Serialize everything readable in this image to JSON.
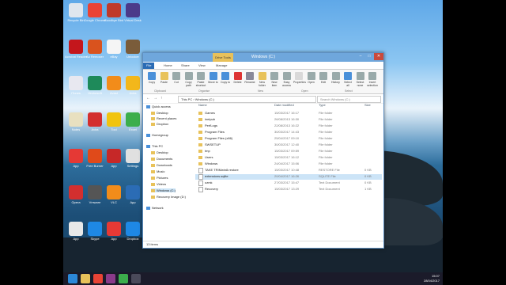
{
  "desktop": {
    "icons": [
      {
        "label": "Recycle Bin",
        "color": "#dfe6ee"
      },
      {
        "label": "Google Chrome",
        "color": "#e94335"
      },
      {
        "label": "Goodbye Bird",
        "color": "#c0392b"
      },
      {
        "label": "Virtual Desk",
        "color": "#4b3a8a"
      },
      {
        "label": "Acrobat Reader DC",
        "color": "#c4161c"
      },
      {
        "label": "Ad Remover",
        "color": "#d9531e"
      },
      {
        "label": "eBay",
        "color": "#f5f5f5"
      },
      {
        "label": "Unlocker",
        "color": "#7a5c3a"
      },
      {
        "label": "iTunes",
        "color": "#e8e8f0"
      },
      {
        "label": "Vectorsoft",
        "color": "#1e8a5a"
      },
      {
        "label": "Avast",
        "color": "#f28c1a"
      },
      {
        "label": "Avira",
        "color": "#f3b71b"
      },
      {
        "label": "Notes",
        "color": "#e8e0c0"
      },
      {
        "label": "Avira",
        "color": "#d32f2f"
      },
      {
        "label": "Tool",
        "color": "#f1c40f"
      },
      {
        "label": "Excel",
        "color": "#3cae4c"
      },
      {
        "label": "App",
        "color": "#e53935"
      },
      {
        "label": "Free Burner",
        "color": "#e04a1a"
      },
      {
        "label": "App",
        "color": "#c62828"
      },
      {
        "label": "Settings",
        "color": "#e0e0e0"
      },
      {
        "label": "Opera",
        "color": "#d32f2f"
      },
      {
        "label": "Vmware",
        "color": "#555"
      },
      {
        "label": "VLC",
        "color": "#f28c1a"
      },
      {
        "label": "App",
        "color": "#2b6cb5"
      },
      {
        "label": "App",
        "color": "#e8e8e8"
      },
      {
        "label": "Skype",
        "color": "#1e88e5"
      },
      {
        "label": "App",
        "color": "#e53935"
      },
      {
        "label": "Dropbox",
        "color": "#1e88e5"
      }
    ]
  },
  "taskbar": {
    "items": [
      {
        "name": "start-button",
        "color": "#2b88d8"
      },
      {
        "name": "file-explorer",
        "color": "#e8c25a"
      },
      {
        "name": "chrome",
        "color": "#e94335"
      },
      {
        "name": "media",
        "color": "#8a3a8a"
      },
      {
        "name": "app",
        "color": "#3cae4c"
      },
      {
        "name": "explorer-active",
        "color": "#4a4a5a"
      }
    ],
    "time": "15:07",
    "date": "28/04/2017"
  },
  "window": {
    "title": "Windows (C:)",
    "tools_tab": "Drive Tools",
    "tabs": [
      "File",
      "Home",
      "Share",
      "View",
      "Manage"
    ],
    "ribbon": {
      "buttons": [
        "Copy",
        "Paste",
        "Cut",
        "Copy path",
        "Paste shortcut",
        "Move to",
        "Copy to",
        "Delete",
        "Rename",
        "New folder",
        "New item",
        "Easy access",
        "Properties",
        "Open",
        "Edit",
        "History",
        "Select all",
        "Select none",
        "Invert selection"
      ],
      "groups": [
        "Clipboard",
        "Organise",
        "New",
        "Open",
        "Select"
      ]
    },
    "address": "This PC  ›  Windows (C:)",
    "search_placeholder": "Search Windows (C:)",
    "nav": [
      {
        "label": "Quick access",
        "indent": 0
      },
      {
        "label": "Desktop",
        "indent": 1
      },
      {
        "label": "Recent places",
        "indent": 1
      },
      {
        "label": "Dropbox",
        "indent": 1
      },
      {
        "label": "Homegroup",
        "indent": 0
      },
      {
        "label": "This PC",
        "indent": 0
      },
      {
        "label": "Desktop",
        "indent": 1
      },
      {
        "label": "Documents",
        "indent": 1
      },
      {
        "label": "Downloads",
        "indent": 1
      },
      {
        "label": "Music",
        "indent": 1
      },
      {
        "label": "Pictures",
        "indent": 1
      },
      {
        "label": "Videos",
        "indent": 1
      },
      {
        "label": "Windows (C:)",
        "indent": 1
      },
      {
        "label": "Recovery Image (D:)",
        "indent": 1
      },
      {
        "label": "Network",
        "indent": 0
      }
    ],
    "columns": [
      "Name",
      "Date modified",
      "Type",
      "Size"
    ],
    "files": [
      {
        "name": "Games",
        "date": "15/03/2017 16:17",
        "type": "File folder",
        "size": "",
        "kind": "folder"
      },
      {
        "name": "inetpub",
        "date": "26/08/2013 16:30",
        "type": "File folder",
        "size": "",
        "kind": "folder"
      },
      {
        "name": "PerfLogs",
        "date": "22/08/2013 16:22",
        "type": "File folder",
        "size": "",
        "kind": "folder"
      },
      {
        "name": "Program Files",
        "date": "30/03/2017 14:43",
        "type": "File folder",
        "size": "",
        "kind": "folder"
      },
      {
        "name": "Program Files (x86)",
        "date": "25/04/2017 09:10",
        "type": "File folder",
        "size": "",
        "kind": "folder"
      },
      {
        "name": "SWSETUP",
        "date": "30/03/2017 12:40",
        "type": "File folder",
        "size": "",
        "kind": "folder"
      },
      {
        "name": "tmp",
        "date": "15/03/2017 09:59",
        "type": "File folder",
        "size": "",
        "kind": "folder"
      },
      {
        "name": "Users",
        "date": "15/03/2017 16:12",
        "type": "File folder",
        "size": "",
        "kind": "folder"
      },
      {
        "name": "Windows",
        "date": "24/04/2017 15:06",
        "type": "File folder",
        "size": "",
        "kind": "folder"
      },
      {
        "name": "TAKE TRIMwin8.restore",
        "date": "15/03/2017 10:48",
        "type": "RESTORE File",
        "size": "0 KB",
        "kind": "file"
      },
      {
        "name": "extensions.sqlite",
        "date": "20/04/2017 16:26",
        "type": "SQLITE File",
        "size": "0 KB",
        "kind": "file"
      },
      {
        "name": "ozmk",
        "date": "27/03/2017 15:47",
        "type": "Text Document",
        "size": "0 KB",
        "kind": "file"
      },
      {
        "name": "Recovery",
        "date": "15/03/2017 13:29",
        "type": "Text Document",
        "size": "1 KB",
        "kind": "file"
      }
    ],
    "selected_index": 10,
    "status": "13 items"
  }
}
